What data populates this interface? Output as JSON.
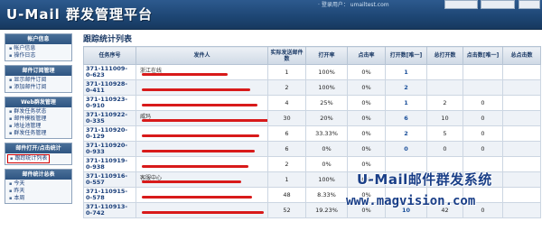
{
  "header": {
    "title": "U-Mail 群发管理平台",
    "login_text": "· 登录用户： umailtest.com"
  },
  "sidebar": {
    "groups": [
      {
        "title": "帐户信息",
        "items": [
          "帐户信息",
          "操作日志"
        ]
      },
      {
        "title": "邮件订阅管理",
        "items": [
          "显示邮件订阅",
          "添加邮件订阅"
        ]
      },
      {
        "title": "Web群发管理",
        "items": [
          "群发任务状态",
          "邮件模板管理",
          "地址池管理",
          "群发任务管理"
        ]
      },
      {
        "title": "邮件打开/点击统计",
        "items": [
          "跟踪统计列表"
        ]
      },
      {
        "title": "邮件统计总表",
        "items": [
          "今天",
          "昨天",
          "本周"
        ]
      }
    ]
  },
  "main": {
    "title": "跟踪统计列表",
    "columns": [
      "任务序号",
      "发件人",
      "实际发送邮件数",
      "打开率",
      "点击率",
      "打开数[唯一]",
      "总打开数",
      "点击数[唯一]",
      "总点击数"
    ],
    "rows": [
      {
        "id": "371-111009-0-623",
        "sender": "浙江在线",
        "sent": "1",
        "open_rate": "100%",
        "click_rate": "0%",
        "opens_unique": "1",
        "opens_total": "",
        "clicks_unique": "",
        "clicks_total": ""
      },
      {
        "id": "371-110928-0-411",
        "sender": "",
        "sent": "2",
        "open_rate": "100%",
        "click_rate": "0%",
        "opens_unique": "2",
        "opens_total": "",
        "clicks_unique": "",
        "clicks_total": ""
      },
      {
        "id": "371-110923-0-910",
        "sender": "",
        "sent": "4",
        "open_rate": "25%",
        "click_rate": "0%",
        "opens_unique": "1",
        "opens_total": "2",
        "clicks_unique": "0",
        "clicks_total": ""
      },
      {
        "id": "371-110922-0-335",
        "sender": "威玛",
        "sent": "30",
        "open_rate": "20%",
        "click_rate": "0%",
        "opens_unique": "6",
        "opens_total": "10",
        "clicks_unique": "0",
        "clicks_total": ""
      },
      {
        "id": "371-110920-0-129",
        "sender": "",
        "sent": "6",
        "open_rate": "33.33%",
        "click_rate": "0%",
        "opens_unique": "2",
        "opens_total": "5",
        "clicks_unique": "0",
        "clicks_total": ""
      },
      {
        "id": "371-110920-0-933",
        "sender": "",
        "sent": "6",
        "open_rate": "0%",
        "click_rate": "0%",
        "opens_unique": "0",
        "opens_total": "0",
        "clicks_unique": "0",
        "clicks_total": ""
      },
      {
        "id": "371-110919-0-938",
        "sender": "",
        "sent": "2",
        "open_rate": "0%",
        "click_rate": "0%",
        "opens_unique": "",
        "opens_total": "",
        "clicks_unique": "",
        "clicks_total": ""
      },
      {
        "id": "371-110916-0-557",
        "sender": "客服中心",
        "sent": "1",
        "open_rate": "100%",
        "click_rate": "0%",
        "opens_unique": "",
        "opens_total": "",
        "clicks_unique": "",
        "clicks_total": ""
      },
      {
        "id": "371-110915-0-578",
        "sender": "",
        "sent": "48",
        "open_rate": "8.33%",
        "click_rate": "0%",
        "opens_unique": "",
        "opens_total": "",
        "clicks_unique": "",
        "clicks_total": ""
      },
      {
        "id": "371-110913-0-742",
        "sender": "",
        "sent": "52",
        "open_rate": "19.23%",
        "click_rate": "0%",
        "opens_unique": "10",
        "opens_total": "42",
        "clicks_unique": "0",
        "clicks_total": ""
      }
    ]
  },
  "watermark": {
    "line1": "U-Mail邮件群发系统",
    "line2": "www.magvision.com"
  }
}
